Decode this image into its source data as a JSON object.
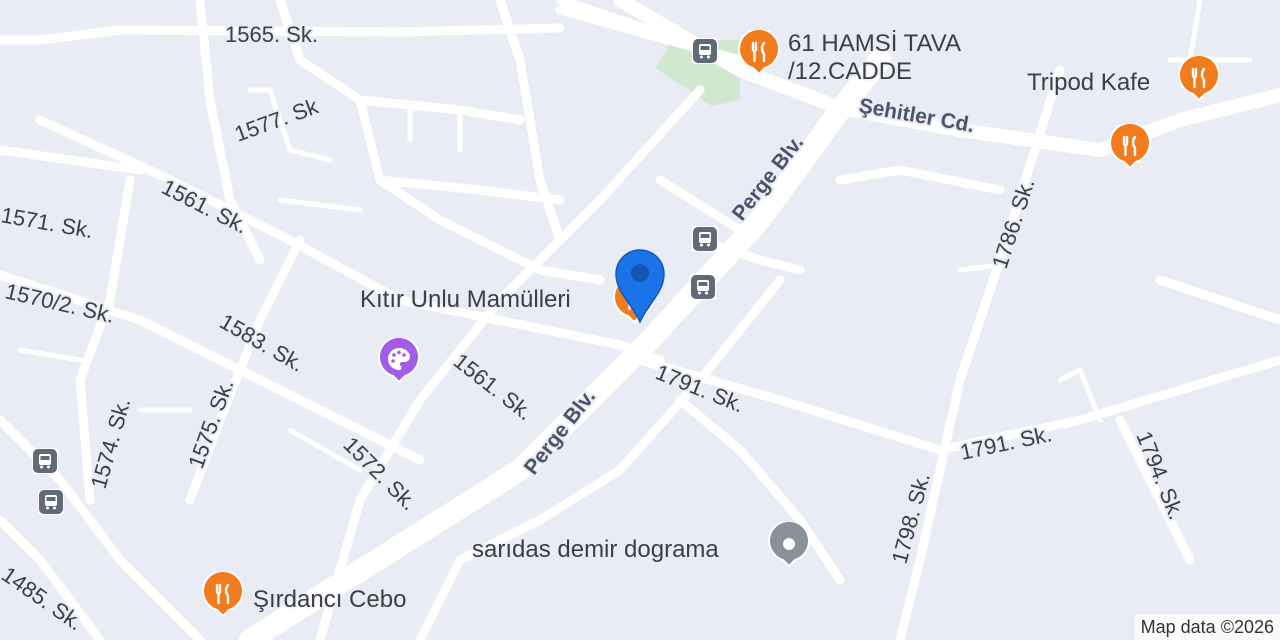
{
  "streets": [
    {
      "label": "1565. Sk."
    },
    {
      "label": "1577. Sk"
    },
    {
      "label": "1561. Sk."
    },
    {
      "label": "1571. Sk."
    },
    {
      "label": "1570/2. Sk."
    },
    {
      "label": "1583. Sk."
    },
    {
      "label": "1561. Sk."
    },
    {
      "label": "Perge Blv."
    },
    {
      "label": "Perge Blv."
    },
    {
      "label": "1791. Sk."
    },
    {
      "label": "1791. Sk."
    },
    {
      "label": "1574. Sk."
    },
    {
      "label": "1575. Sk."
    },
    {
      "label": "1572. Sk."
    },
    {
      "label": "1485. Sk."
    },
    {
      "label": "Şehitler Cd."
    },
    {
      "label": "1786. Sk."
    },
    {
      "label": "1798. Sk."
    },
    {
      "label": "1794. Sk."
    }
  ],
  "pois": {
    "hamsi_line1": "61 HAMSİ TAVA",
    "hamsi_line2": "/12.CADDE",
    "tripod": "Tripod Kafe",
    "kitir": "Kıtır Unlu Mamülleri",
    "saridas": "sarıdas demir dograma",
    "sirdanci": "Şırdancı Cebo"
  },
  "icons": {
    "restaurant": "fork-knife-icon",
    "art": "palette-icon",
    "generic": "place-dot-icon",
    "bus": "bus-stop-icon",
    "location": "location-pin-icon"
  },
  "colors": {
    "background": "#e9ebf5",
    "road": "#ffffff",
    "park": "#cfe8cf",
    "restaurant_pin": "#f07c1e",
    "art_pin": "#a35ce8",
    "generic_pin": "#8a9199",
    "location_pin": "#1a73e8",
    "bus_bg": "#5f6b7a"
  },
  "attribution": "Map data ©2026"
}
